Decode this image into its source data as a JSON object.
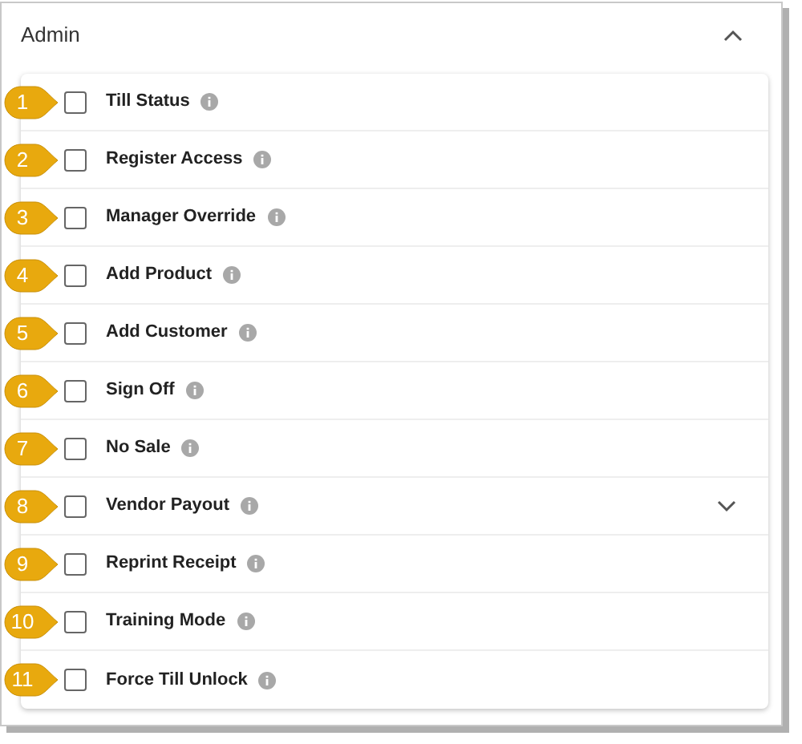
{
  "section": {
    "title": "Admin",
    "expanded": true
  },
  "permissions": [
    {
      "callout": "1",
      "label": "Till Status",
      "checked": false,
      "expandable": false
    },
    {
      "callout": "2",
      "label": "Register Access",
      "checked": false,
      "expandable": false
    },
    {
      "callout": "3",
      "label": "Manager Override",
      "checked": false,
      "expandable": false
    },
    {
      "callout": "4",
      "label": "Add Product",
      "checked": false,
      "expandable": false
    },
    {
      "callout": "5",
      "label": "Add Customer",
      "checked": false,
      "expandable": false
    },
    {
      "callout": "6",
      "label": "Sign Off",
      "checked": false,
      "expandable": false
    },
    {
      "callout": "7",
      "label": "No Sale",
      "checked": false,
      "expandable": false
    },
    {
      "callout": "8",
      "label": "Vendor Payout",
      "checked": false,
      "expandable": true
    },
    {
      "callout": "9",
      "label": "Reprint Receipt",
      "checked": false,
      "expandable": false
    },
    {
      "callout": "10",
      "label": "Training Mode",
      "checked": false,
      "expandable": false
    },
    {
      "callout": "11",
      "label": "Force Till Unlock",
      "checked": false,
      "expandable": false
    }
  ]
}
